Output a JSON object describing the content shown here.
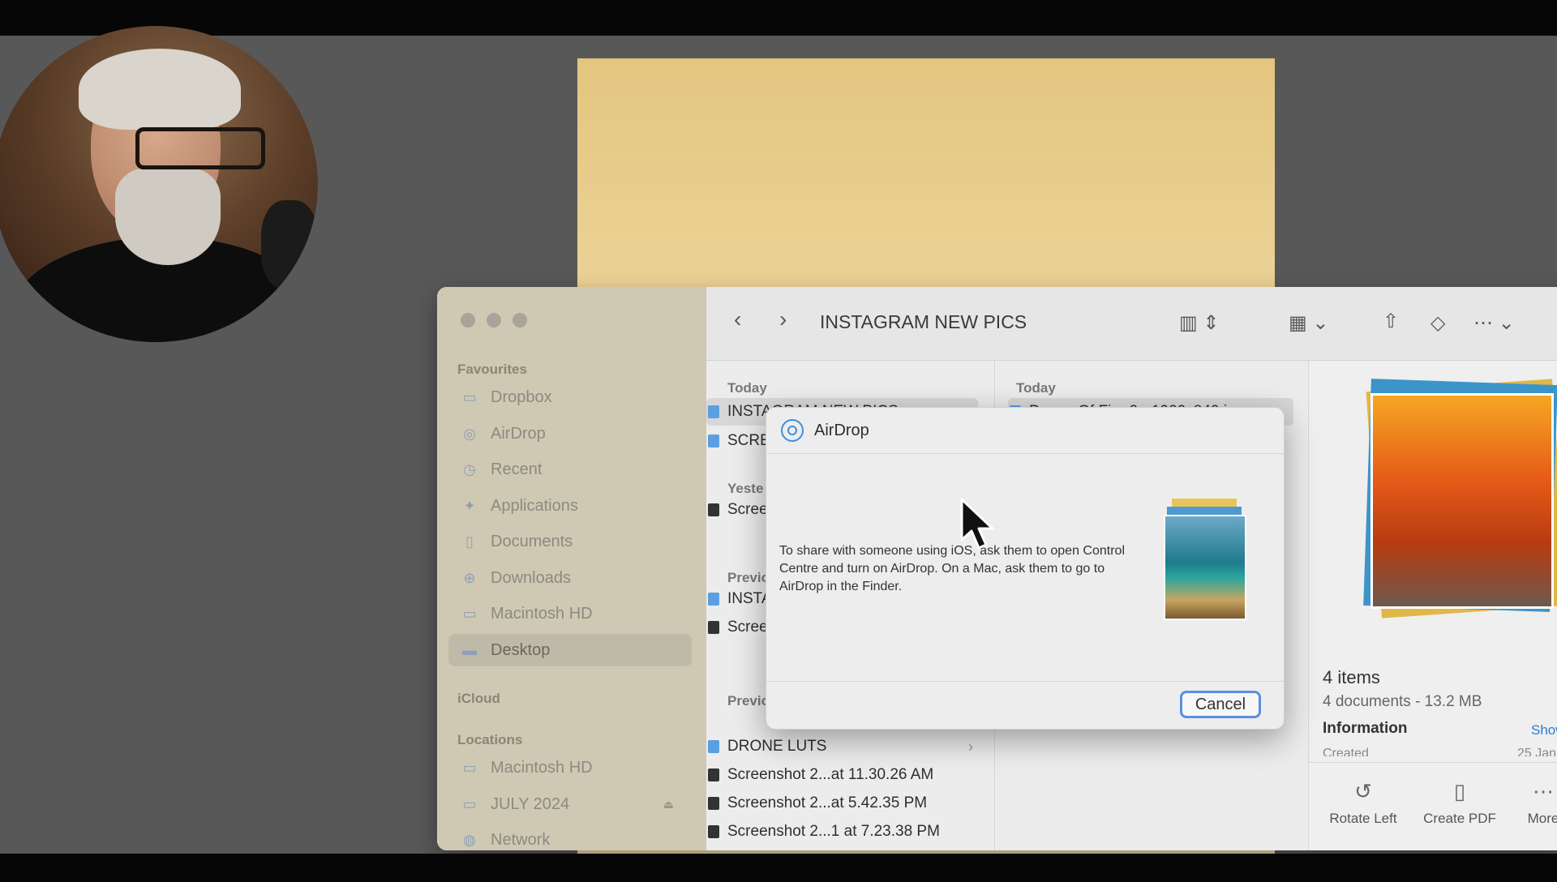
{
  "finder": {
    "title": "INSTAGRAM NEW PICS",
    "sidebar": {
      "favourites_label": "Favourites",
      "favourites": [
        {
          "label": "Dropbox",
          "icon": "folder-icon"
        },
        {
          "label": "AirDrop",
          "icon": "airdrop-icon"
        },
        {
          "label": "Recent",
          "icon": "clock-icon"
        },
        {
          "label": "Applications",
          "icon": "applications-icon"
        },
        {
          "label": "Documents",
          "icon": "document-icon"
        },
        {
          "label": "Downloads",
          "icon": "download-icon"
        },
        {
          "label": "Macintosh HD",
          "icon": "disk-icon"
        },
        {
          "label": "Desktop",
          "icon": "desktop-icon",
          "selected": true
        }
      ],
      "icloud_label": "iCloud",
      "locations_label": "Locations",
      "locations": [
        {
          "label": "Macintosh HD",
          "icon": "disk-icon"
        },
        {
          "label": "JULY 2024",
          "icon": "disk-icon"
        },
        {
          "label": "Network",
          "icon": "network-icon"
        }
      ]
    },
    "columns": {
      "col1": {
        "today": "Today",
        "rows_today": [
          "INSTAGRAM NEW PICS",
          "SCRE"
        ],
        "yesterday": "Yeste",
        "rows_yesterday": [
          "Scree"
        ],
        "previous1": "Previo",
        "rows_previous1": [
          "INSTA",
          "Scree"
        ],
        "previous2": "Previo",
        "rows_previous2": [
          "DRONE LUTS",
          "Screenshot 2...at 11.30.26 AM",
          "Screenshot 2...at 5.42.35 PM",
          "Screenshot 2...1 at 7.23.38 PM"
        ]
      },
      "col2": {
        "today": "Today",
        "rows_today": [
          "Dunes Of Fire 2 - 1920x840.jpg"
        ]
      }
    },
    "preview": {
      "count": "4 items",
      "summary": "4 documents - 13.2 MB",
      "info_heading": "Information",
      "show": "Show",
      "created_label": "Created",
      "created_value": "25 Jan",
      "actions": [
        {
          "label": "Rotate Left",
          "icon": "rotate-left-icon"
        },
        {
          "label": "Create PDF",
          "icon": "pdf-icon"
        },
        {
          "label": "More",
          "icon": "more-icon"
        }
      ]
    }
  },
  "dialog": {
    "title": "AirDrop",
    "message": "To share with someone using iOS, ask them to open Control Centre and turn on AirDrop. On a Mac, ask them to go to AirDrop in the Finder.",
    "cancel_label": "Cancel"
  },
  "colors": {
    "accent": "#3d8fe0",
    "sidebar_tint": "#cfc9b3"
  }
}
